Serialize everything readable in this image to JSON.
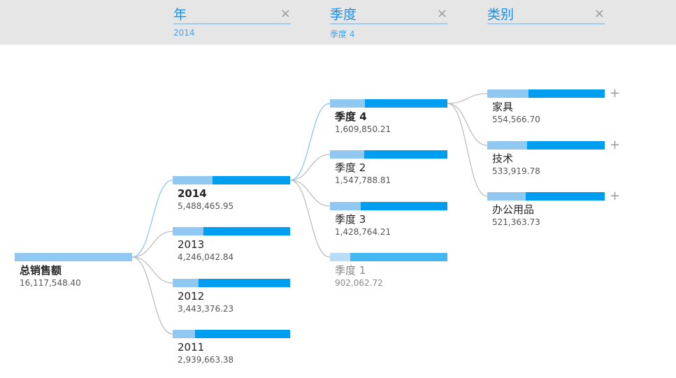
{
  "header": {
    "columns": [
      {
        "title": "年",
        "selected": "2014"
      },
      {
        "title": "季度",
        "selected": "季度 4"
      },
      {
        "title": "类别",
        "selected": ""
      }
    ],
    "close_glyph": "×"
  },
  "chart_data": {
    "type": "decomposition-tree",
    "root": {
      "label": "总销售额",
      "value": 16117548.4,
      "display": "16,117,548.40"
    },
    "levels": [
      {
        "name": "年",
        "nodes": [
          {
            "label": "2014",
            "value": 5488465.95,
            "display": "5,488,465.95",
            "selected": true
          },
          {
            "label": "2013",
            "value": 4246042.84,
            "display": "4,246,042.84"
          },
          {
            "label": "2012",
            "value": 3443376.23,
            "display": "3,443,376.23"
          },
          {
            "label": "2011",
            "value": 2939663.38,
            "display": "2,939,663.38"
          }
        ]
      },
      {
        "name": "季度",
        "nodes": [
          {
            "label": "季度 4",
            "value": 1609850.21,
            "display": "1,609,850.21",
            "selected": true
          },
          {
            "label": "季度 2",
            "value": 1547788.81,
            "display": "1,547,788.81"
          },
          {
            "label": "季度 3",
            "value": 1428764.21,
            "display": "1,428,764.21"
          },
          {
            "label": "季度 1",
            "value": 902062.72,
            "display": "902,062.72",
            "dim": true
          }
        ]
      },
      {
        "name": "类别",
        "nodes": [
          {
            "label": "家具",
            "value": 554566.7,
            "display": "554,566.70"
          },
          {
            "label": "技术",
            "value": 533919.78,
            "display": "533,919.78"
          },
          {
            "label": "办公用品",
            "value": 521363.73,
            "display": "521,363.73"
          }
        ]
      }
    ],
    "expand_glyph": "+",
    "colors": {
      "bar_dark": "#009ef0",
      "bar_light": "#91c8f2",
      "link_selected": "#8cc7f0",
      "link": "#bdbdbd",
      "header_bg": "#e6e6e6",
      "header_text": "#1b8fe6"
    }
  }
}
